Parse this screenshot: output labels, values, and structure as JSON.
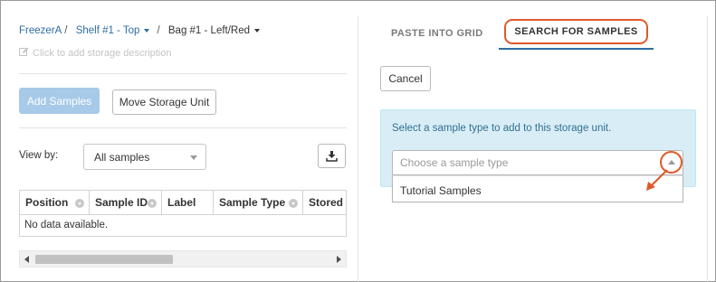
{
  "breadcrumb": {
    "items": [
      {
        "label": "FreezerA",
        "has_caret": false
      },
      {
        "label": "Shelf #1 - Top",
        "has_caret": true
      },
      {
        "label": "Bag #1 - Left/Red",
        "has_caret": true
      }
    ]
  },
  "storage": {
    "description_placeholder": "Click to add storage description"
  },
  "actions": {
    "add_samples_label": "Add Samples",
    "move_storage_unit_label": "Move Storage Unit"
  },
  "view_by": {
    "label": "View by:",
    "selected": "All samples"
  },
  "grid": {
    "columns": [
      "Position",
      "Sample ID",
      "Label",
      "Sample Type",
      "Stored Am"
    ],
    "empty_message": "No data available."
  },
  "tabs": {
    "paste_label": "PASTE INTO GRID",
    "search_label": "SEARCH FOR SAMPLES",
    "active": "search"
  },
  "search_panel": {
    "cancel_label": "Cancel",
    "instruction": "Select a sample type to add to this storage unit.",
    "select_placeholder": "Choose a sample type",
    "options": [
      "Tutorial Samples"
    ]
  },
  "colors": {
    "link": "#2e6da4",
    "highlight": "#e0592a",
    "info_bg": "#d9edf7",
    "info_text": "#31708f",
    "disabled_primary": "#a7cae9"
  },
  "icons": {
    "edit": "pencil-square-icon",
    "download": "download-icon",
    "dropdown": "caret-icon"
  }
}
